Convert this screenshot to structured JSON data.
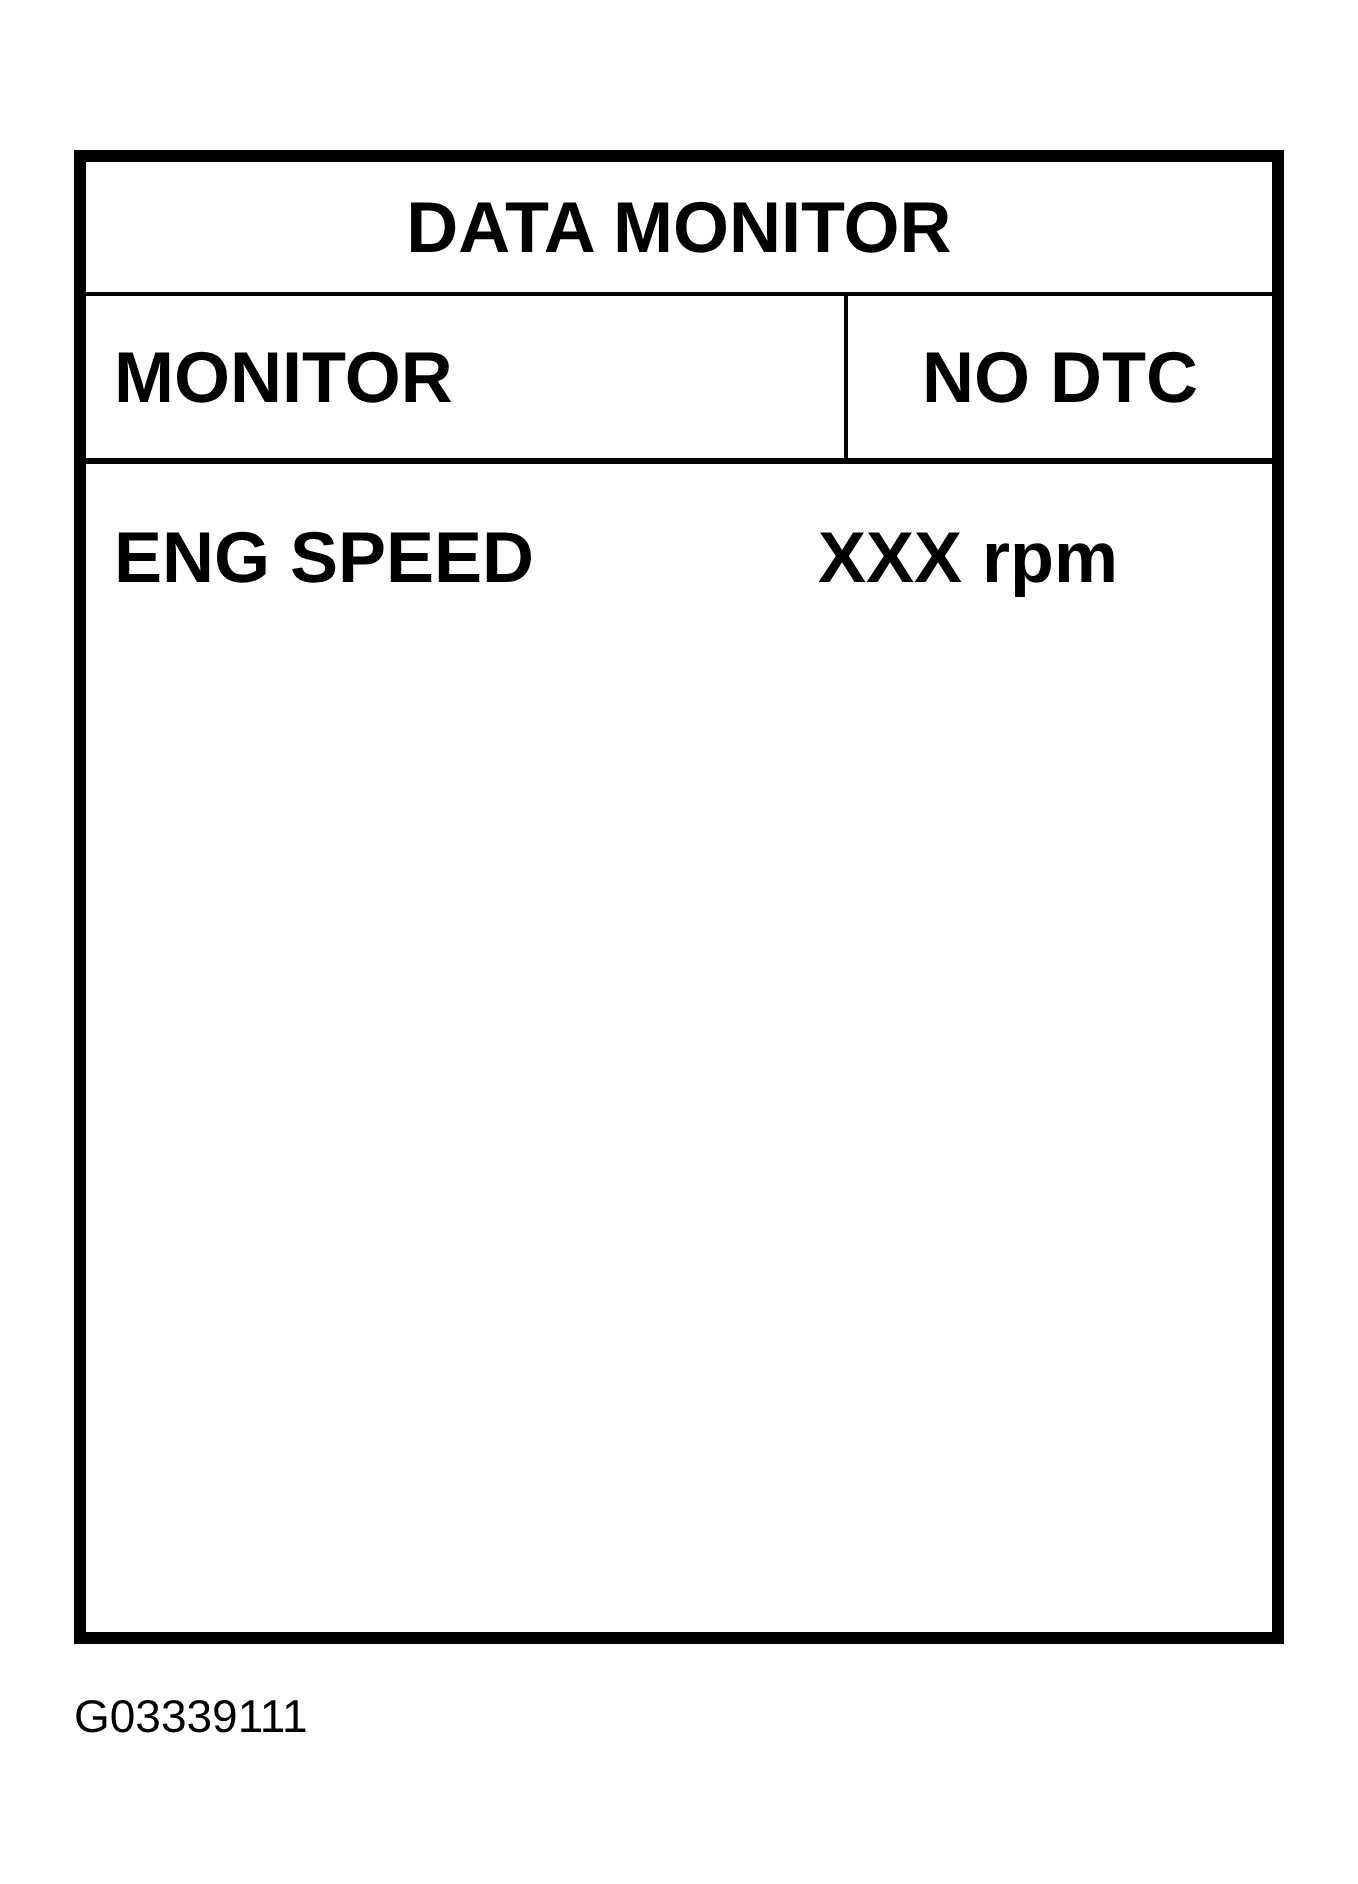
{
  "title": "DATA MONITOR",
  "header": {
    "mode": "MONITOR",
    "status": "NO DTC"
  },
  "rows": [
    {
      "item": "ENG SPEED",
      "value": "XXX rpm"
    }
  ],
  "figure_code": "G03339111"
}
